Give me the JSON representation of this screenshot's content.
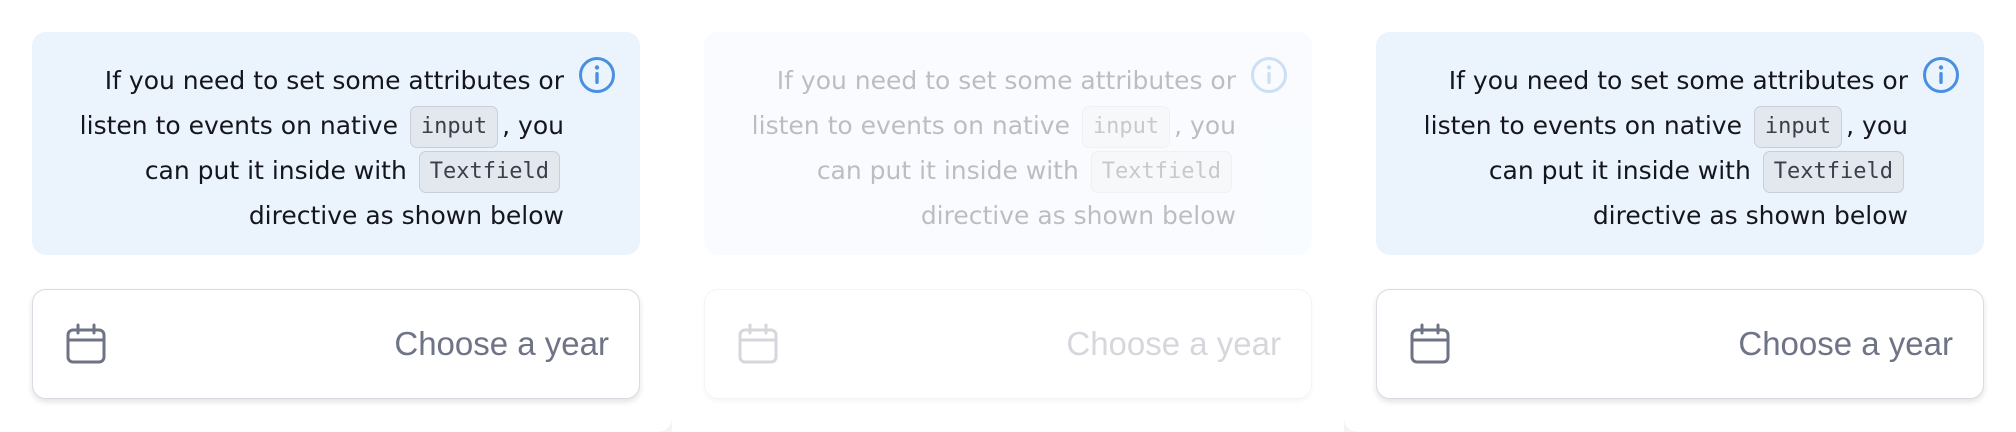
{
  "panels": [
    {
      "info": {
        "line1": "If you need to set some attributes or",
        "line2_pre": "listen to events on native",
        "code_input": "input",
        "line2_post": ", you",
        "line3_pre": "can put it inside with",
        "code_textfield": "Textfield",
        "line4": "directive as shown below"
      },
      "field": {
        "placeholder": "Choose a year"
      },
      "icons": {
        "info": "info-circle-icon",
        "field": "calendar-icon"
      }
    },
    {
      "info": {
        "line1": "If you need to set some attributes or",
        "line2_pre": "listen to events on native",
        "code_input": "input",
        "line2_post": ", you",
        "line3_pre": "can put it inside with",
        "code_textfield": "Textfield",
        "line4": "directive as shown below"
      },
      "field": {
        "placeholder": "Choose a year"
      },
      "icons": {
        "info": "info-circle-icon",
        "field": "calendar-icon"
      }
    },
    {
      "info": {
        "line1": "If you need to set some attributes or",
        "line2_pre": "listen to events on native",
        "code_input": "input",
        "line2_post": ", you",
        "line3_pre": "can put it inside with",
        "code_textfield": "Textfield",
        "line4": "directive as shown below"
      },
      "field": {
        "placeholder": "Choose a year"
      },
      "icons": {
        "info": "info-circle-icon",
        "field": "calendar-icon"
      }
    }
  ],
  "colors": {
    "info_background": "#ebf3fd",
    "info_icon": "#4a90e2",
    "text": "#14161c",
    "placeholder": "#6e7385",
    "field_border": "#d8dbe2"
  }
}
